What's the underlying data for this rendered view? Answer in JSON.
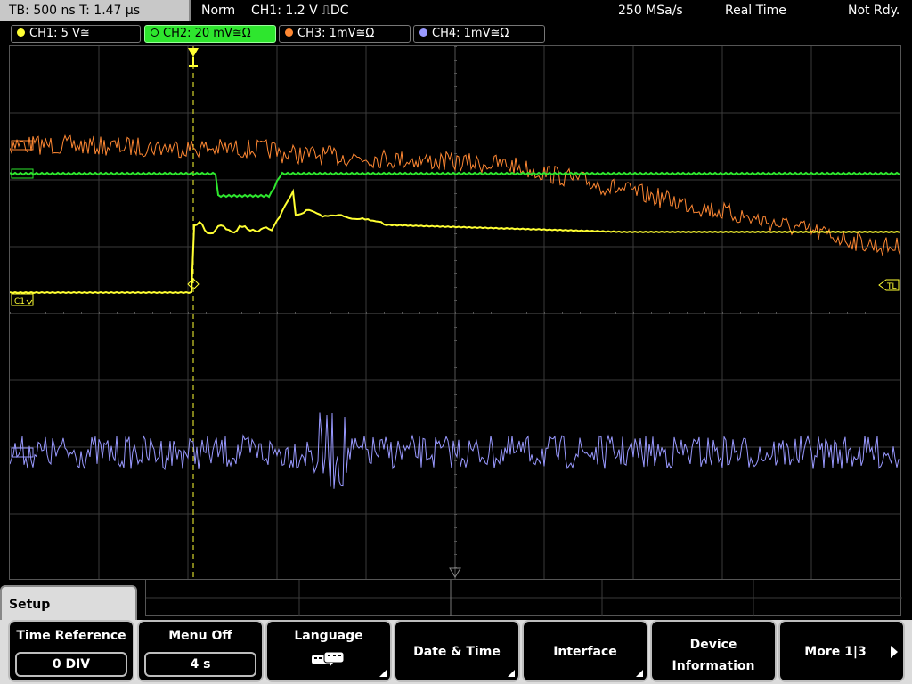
{
  "status": {
    "timebase": "TB: 500 ns   T: 1.47 µs",
    "mode": "Norm",
    "trigger": "CH1: 1.2 V ⎍DC",
    "sample_rate": "250 MSa/s",
    "acq_mode": "Real Time",
    "trig_state": "Not Rdy."
  },
  "channels": [
    {
      "label": "CH1: 5 V≅",
      "color": "#ffff33"
    },
    {
      "label": "CH2: 20 mV≅Ω",
      "color": "#2ee62e"
    },
    {
      "label": "CH3: 1mV≅Ω",
      "color": "#ff8833"
    },
    {
      "label": "CH4: 1mV≅Ω",
      "color": "#9999ff"
    }
  ],
  "markers": {
    "ch1": "C1",
    "trigger_level": "TL"
  },
  "menu": {
    "title": "Setup",
    "time_reference": {
      "label": "Time Reference",
      "value": "0 DIV"
    },
    "menu_off": {
      "label": "Menu Off",
      "value": "4 s"
    },
    "language": {
      "label": "Language",
      "icon": "keyboard-icon"
    },
    "date_time": {
      "label": "Date & Time"
    },
    "interface": {
      "label": "Interface"
    },
    "device_info": {
      "line1": "Device",
      "line2": "Information"
    },
    "more": {
      "label": "More 1|3"
    }
  }
}
